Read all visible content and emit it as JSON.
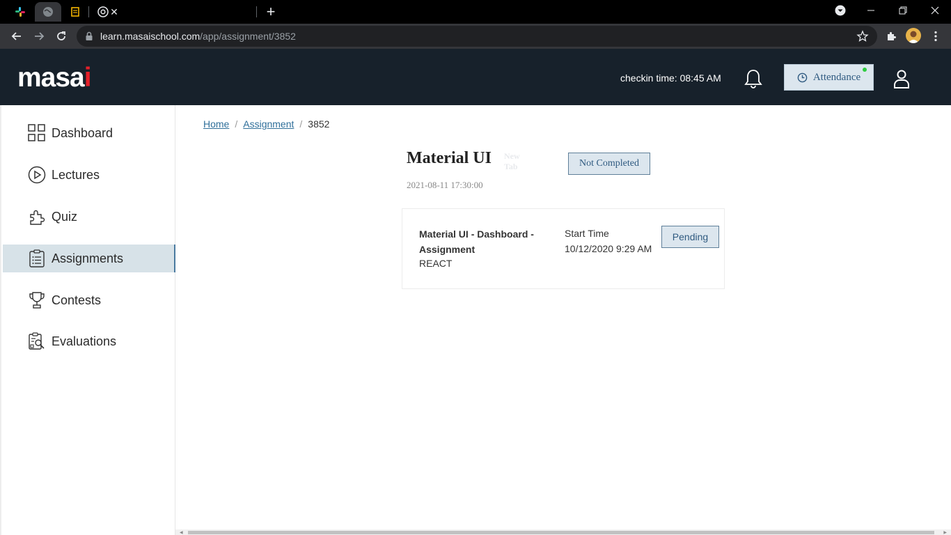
{
  "browser": {
    "tabs": [
      {
        "label": ""
      },
      {
        "label": ""
      },
      {
        "label": ""
      },
      {
        "label": "New Tab"
      }
    ],
    "new_tab_symbol": "+",
    "close_symbol": "✕",
    "url_host": "learn.masaischool.com",
    "url_path": "/app/assignment/3852"
  },
  "header": {
    "logo_text": "masa",
    "logo_accent": "i",
    "checkin_text": "checkin time: 08:45 AM",
    "attendance_label": "Attendance"
  },
  "sidebar": {
    "items": [
      {
        "label": "Dashboard",
        "icon": "dashboard-grid-icon"
      },
      {
        "label": "Lectures",
        "icon": "play-circle-icon"
      },
      {
        "label": "Quiz",
        "icon": "puzzle-icon"
      },
      {
        "label": "Assignments",
        "icon": "clipboard-list-icon",
        "active": true
      },
      {
        "label": "Contests",
        "icon": "trophy-icon"
      },
      {
        "label": "Evaluations",
        "icon": "evaluation-icon"
      }
    ]
  },
  "breadcrumb": {
    "home": "Home",
    "assignment": "Assignment",
    "current": "3852",
    "separator": "/"
  },
  "assignment": {
    "title": "Material UI",
    "status": "Not Completed",
    "date": "2021-08-11 17:30:00"
  },
  "card": {
    "title": "Material UI - Dashboard - Assignment",
    "tag": "REACT",
    "start_time_label": "Start Time",
    "start_time_value": "10/12/2020 9:29 AM",
    "status": "Pending"
  },
  "colors": {
    "header_bg": "#17212b",
    "accent_red": "#e5202a",
    "badge_bg": "#dce6ee",
    "badge_text": "#2f5a80",
    "active_nav_bg": "#d7e2e8"
  }
}
